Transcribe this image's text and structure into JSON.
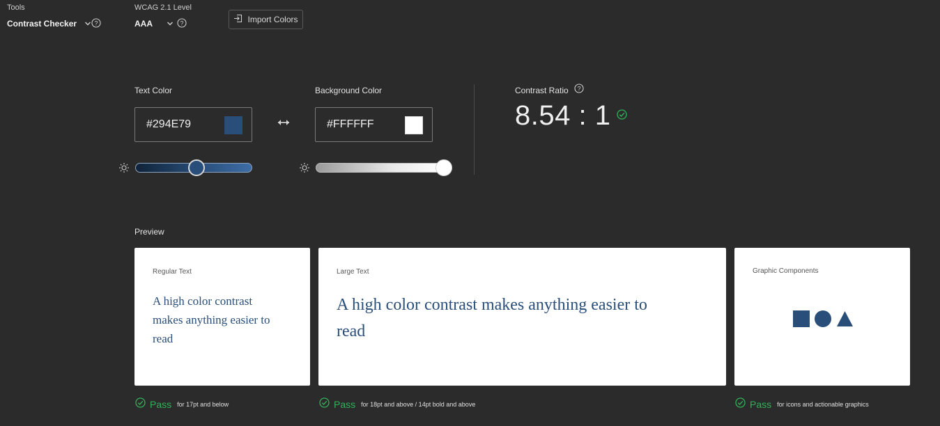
{
  "toolbar": {
    "tools_label": "Tools",
    "tools_value": "Contrast Checker",
    "wcag_label": "WCAG 2.1 Level",
    "wcag_value": "AAA",
    "import_label": "Import Colors"
  },
  "text_color": {
    "label": "Text Color",
    "value": "#294E79",
    "swatch": "#294E79",
    "brightness": 0.53
  },
  "background_color": {
    "label": "Background Color",
    "value": "#FFFFFF",
    "swatch": "#FFFFFF",
    "brightness": 1.0
  },
  "contrast": {
    "label": "Contrast Ratio",
    "value": "8.54 : 1"
  },
  "preview": {
    "label": "Preview",
    "regular": {
      "label": "Regular Text",
      "text": "A high color contrast makes anything easier to read",
      "pass_word": "Pass",
      "pass_desc": "for 17pt and below"
    },
    "large": {
      "label": "Large Text",
      "text": "A high color contrast makes anything easier to read",
      "pass_word": "Pass",
      "pass_desc": "for 18pt and above / 14pt bold and above"
    },
    "graphic": {
      "label": "Graphic Components",
      "pass_word": "Pass",
      "pass_desc": "for icons and actionable graphics"
    }
  },
  "colors": {
    "background": "#2b2b2b",
    "accent_pass": "#31b25a",
    "text_color": "#294E79"
  },
  "icons": {
    "dropdown": "chevron-down-icon",
    "help": "help-circle-icon",
    "import": "import-icon",
    "swap": "swap-arrows-icon",
    "brightness": "sun-icon",
    "pass": "check-circle-icon"
  }
}
